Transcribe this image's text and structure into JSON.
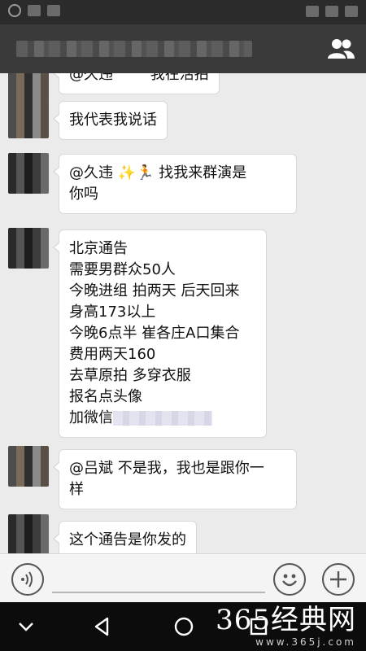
{
  "header": {},
  "messages": [
    {
      "lines": [
        "@久违",
        "我在活拍"
      ]
    },
    {
      "lines": [
        "我代表我说话"
      ]
    },
    {
      "lines": [
        "@久违  ✨🏃 找我来群演是",
        "你吗"
      ]
    },
    {
      "lines": [
        "北京通告",
        "需要男群众50人",
        "今晚进组 拍两天 后天回来",
        "身高173以上",
        "今晚6点半 崔各庄A口集合",
        "费用两天160",
        "去草原拍 多穿衣服",
        "报名点头像",
        "加微信"
      ]
    },
    {
      "lines": [
        "@吕斌 不是我，我也是跟你一",
        "样"
      ]
    },
    {
      "lines": [
        "这个通告是你发的"
      ]
    }
  ],
  "input": {
    "placeholder": ""
  },
  "icons": {
    "group": "group-members-icon",
    "voice": "voice-icon",
    "emoji": "emoji-icon",
    "plus": "plus-icon",
    "back": "back-icon",
    "home": "home-icon",
    "recents": "recents-icon",
    "expand": "chevron-down-icon"
  },
  "watermark": {
    "main": "365经典网",
    "sub": "www.365j.com"
  }
}
